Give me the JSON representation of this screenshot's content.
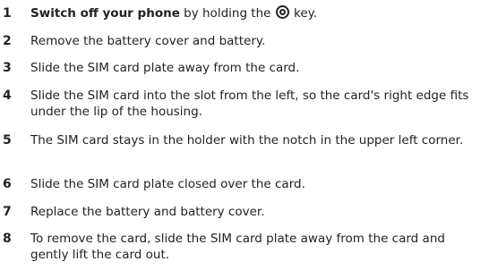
{
  "steps": [
    {
      "number": "1",
      "bold_text": "Switch off your phone",
      "text_before_icon": " by holding the ",
      "icon": "power-key-icon",
      "text_after_icon": " key."
    },
    {
      "number": "2",
      "text": "Remove the battery cover and battery."
    },
    {
      "number": "3",
      "text": "Slide the SIM card plate away from the card."
    },
    {
      "number": "4",
      "text": "Slide the SIM card into the slot from the left, so the card's right edge fits under the lip of the housing."
    },
    {
      "number": "5",
      "text": "The SIM card stays in the holder with the notch in the upper left corner."
    },
    {
      "number": "6",
      "text": "Slide the SIM card plate closed over the card."
    },
    {
      "number": "7",
      "text": "Replace the battery and battery cover."
    },
    {
      "number": "8",
      "text": "To remove the card, slide the SIM card plate away from the card and gently lift the card out."
    }
  ]
}
